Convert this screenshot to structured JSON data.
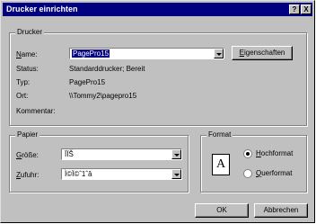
{
  "window": {
    "title": "Drucker einrichten",
    "help_btn": "?",
    "close_btn": "X"
  },
  "printer": {
    "group_label": "Drucker",
    "name_label": "Name:",
    "name_value": "PagePro15",
    "properties_button": "Eigenschaften",
    "status_label": "Status:",
    "status_value": "Standarddrucker; Bereit",
    "type_label": "Typ:",
    "type_value": "PagePro15",
    "location_label": "Ort:",
    "location_value": "\\\\Tommy2\\pagepro15",
    "comment_label": "Kommentar:"
  },
  "paper": {
    "group_label": "Papier",
    "size_label": "Größe:",
    "size_value": "ÏÏŠ",
    "source_label": "Zufuhr:",
    "source_value": "Ì©Ï©ˆ1ˆâ"
  },
  "format": {
    "group_label": "Format",
    "icon_letter": "A",
    "portrait_label": "Hochformat",
    "landscape_label": "Querformat",
    "selected": "Hochformat"
  },
  "buttons": {
    "ok": "OK",
    "cancel": "Abbrechen"
  }
}
